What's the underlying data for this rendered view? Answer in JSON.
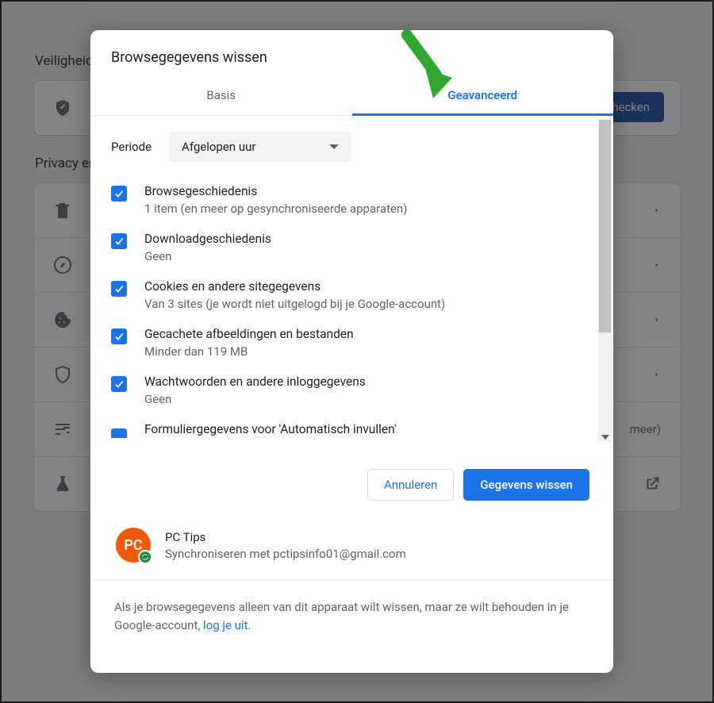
{
  "background": {
    "heading_safety": "Veiligheidscheck",
    "nu_checken": "Nu checken",
    "heading_privacy": "Privacy en beveiliging",
    "meer": "meer)"
  },
  "dialog": {
    "title": "Browsegegevens wissen",
    "tabs": {
      "basic": "Basis",
      "advanced": "Geavanceerd"
    },
    "period": {
      "label": "Periode",
      "selected": "Afgelopen uur"
    },
    "items": [
      {
        "title": "Browsegeschiedenis",
        "sub": "1 item (en meer op gesynchroniseerde apparaten)"
      },
      {
        "title": "Downloadgeschiedenis",
        "sub": "Geen"
      },
      {
        "title": "Cookies en andere sitegegevens",
        "sub": "Van 3 sites (je wordt niet uitgelogd bij je Google-account)"
      },
      {
        "title": "Gecachete afbeeldingen en bestanden",
        "sub": "Minder dan 119 MB"
      },
      {
        "title": "Wachtwoorden en andere inloggegevens",
        "sub": "Geen"
      },
      {
        "title": "Formuliergegevens voor 'Automatisch invullen'",
        "sub": ""
      }
    ],
    "buttons": {
      "cancel": "Annuleren",
      "confirm": "Gegevens wissen"
    },
    "account": {
      "avatar_initials": "PC",
      "name": "PC Tips",
      "sub": "Synchroniseren met pctipsinfo01@gmail.com"
    },
    "footer": {
      "text_before_link": "Als je browsegegevens alleen van dit apparaat wilt wissen, maar ze wilt behouden in je Google-account, ",
      "link_text": "log je uit",
      "text_after_link": "."
    }
  }
}
